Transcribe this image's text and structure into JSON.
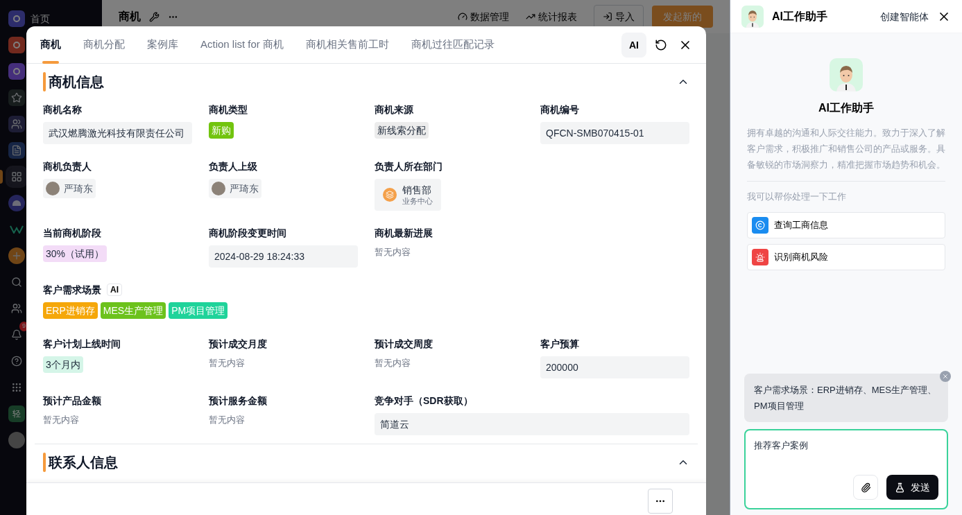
{
  "sidebar": {
    "items": [
      {
        "kind": "q1",
        "label": "首页",
        "selected": false
      },
      {
        "kind": "q2",
        "selected": false
      },
      {
        "kind": "q3",
        "selected": false
      },
      {
        "kind": "star",
        "selected": false
      },
      {
        "kind": "team",
        "selected": false
      },
      {
        "kind": "doc",
        "selected": false
      },
      {
        "kind": "grid",
        "selected": true
      },
      {
        "kind": "circle",
        "selected": false
      },
      {
        "kind": "w",
        "selected": false
      },
      {
        "kind": "plus",
        "selected": false
      },
      {
        "kind": "search",
        "selected": false
      },
      {
        "kind": "users",
        "selected": false
      },
      {
        "kind": "bell",
        "badge": "9",
        "selected": false
      },
      {
        "kind": "help",
        "selected": false
      },
      {
        "kind": "dots",
        "selected": false
      },
      {
        "kind": "text",
        "text": "轻",
        "selected": false
      },
      {
        "kind": "avatar",
        "selected": false
      }
    ]
  },
  "page_header": {
    "title": "商机",
    "actions": [
      "数据管理",
      "统计报表"
    ],
    "import_button": "导入",
    "create_button": "发起新的"
  },
  "modal": {
    "tabs": [
      {
        "label": "商机",
        "selected": true
      },
      {
        "label": "商机分配",
        "selected": false
      },
      {
        "label": "案例库",
        "selected": false
      },
      {
        "label": "Action list for 商机",
        "selected": false
      },
      {
        "label": "商机相关售前工时",
        "selected": false
      },
      {
        "label": "商机过往匹配记录",
        "selected": false
      }
    ],
    "ai_button": "AI",
    "sections": [
      {
        "title": "商机信息",
        "expanded": true,
        "rows": [
          [
            {
              "label": "商机名称",
              "kind": "text",
              "value": "武汉燃腾激光科技有限责任公司"
            },
            {
              "label": "商机类型",
              "kind": "tag",
              "value": "新购",
              "color": "#72c40f"
            },
            {
              "label": "商机来源",
              "kind": "tag",
              "value": "新线索分配",
              "color": "#ececec"
            },
            {
              "label": "商机编号",
              "kind": "text",
              "value": "QFCN-SMB070415-01"
            }
          ],
          [
            {
              "label": "商机负责人",
              "kind": "person",
              "value": "严琦东"
            },
            {
              "label": "负责人上级",
              "kind": "person",
              "value": "严琦东"
            },
            {
              "label": "负责人所在部门",
              "kind": "dept",
              "value": "销售部",
              "sub": "业务中心"
            }
          ],
          [
            {
              "label": "当前商机阶段",
              "kind": "tag",
              "value": "30%（试用）",
              "color": "#f3dcf7"
            },
            {
              "label": "商机阶段变更时间",
              "kind": "text",
              "value": "2024-08-29 18:24:33"
            },
            {
              "label": "商机最新进展",
              "kind": "empty",
              "value": "暂无内容"
            }
          ],
          [
            {
              "label": "客户需求场景",
              "badge": "AI",
              "kind": "tags",
              "tags": [
                {
                  "label": "ERP进销存",
                  "color": "#f5a70a"
                },
                {
                  "label": "MES生产管理",
                  "color": "#6cc21c"
                },
                {
                  "label": "PM项目管理",
                  "color": "#1fd39a"
                }
              ]
            }
          ],
          [
            {
              "label": "客户计划上线时间",
              "kind": "tag",
              "value": "3个月内",
              "color": "#d5f5e8"
            },
            {
              "label": "预计成交月度",
              "kind": "empty",
              "value": "暂无内容"
            },
            {
              "label": "预计成交周度",
              "kind": "empty",
              "value": "暂无内容"
            },
            {
              "label": "客户预算",
              "kind": "text",
              "value": "200000"
            }
          ],
          [
            {
              "label": "预计产品金额",
              "kind": "empty",
              "value": "暂无内容"
            },
            {
              "label": "预计服务金额",
              "kind": "empty",
              "value": "暂无内容"
            },
            {
              "label": "竞争对手（SDR获取）",
              "kind": "text",
              "value": "简道云",
              "wide": true
            }
          ]
        ]
      },
      {
        "title": "联系人信息",
        "expanded": true
      }
    ]
  },
  "assistant": {
    "title": "AI工作助手",
    "create_link": "创建智能体",
    "name": "AI工作助手",
    "description": "拥有卓越的沟通和人际交往能力。致力于深入了解客户需求，积极推广和销售公司的产品或服务。具备敏锐的市场洞察力，精准把握市场趋势和机会。",
    "prompt_heading": "我可以帮你处理一下工作",
    "skills": [
      {
        "kind": "company",
        "label": "查询工商信息",
        "color": "#1a8cf0"
      },
      {
        "kind": "alarm",
        "label": "识别商机风险",
        "color": "#ef4444"
      }
    ],
    "quote": "客户需求场景：ERP进销存、MES生产管理、PM项目管理",
    "input": {
      "value": "推荐客户案例"
    },
    "send_button": "发送"
  }
}
